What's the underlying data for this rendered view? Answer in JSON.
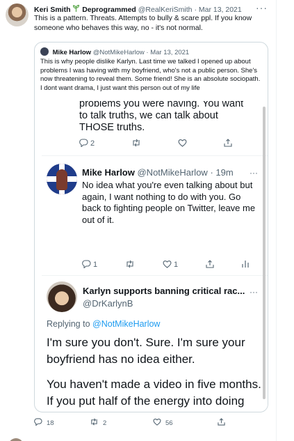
{
  "tweet": {
    "author_name": "Keri Smith",
    "author_tag": "Deprogrammed",
    "author_handle": "@RealKeriSmith",
    "date": "Mar 13, 2021",
    "more": "···",
    "text": "This is a pattern. Threats. Attempts to bully & scare ppl. If you know someone who behaves this way, no - it's not normal.",
    "actions": {
      "reply": "18",
      "retweet": "2",
      "like": "56"
    }
  },
  "quote": {
    "author_name": "Mike Harlow",
    "author_handle": "@NotMikeHarlow",
    "date": "Mar 13, 2021",
    "text": "This is why people dislike Karlyn. Last time we talked I opened up about problems I was having with my boyfriend, who's not a public person. She's now threatening to reveal them. Some friend! She is an absolute sociopath. I dont want drama, I just want this person out of my life"
  },
  "screenshot": {
    "fragment": "problems you were having. You want to talk truths, we can talk about THOSE truths.",
    "fragment_actions": {
      "reply": "2"
    },
    "mike": {
      "name": "Mike Harlow",
      "handle": "@NotMikeHarlow",
      "time": "19m",
      "more": "···",
      "text": "No idea what you're even talking about but again, I want nothing to do with you. Go back to fighting people on Twitter, leave me out of it.",
      "actions": {
        "reply": "1",
        "like": "1"
      }
    },
    "karlyn": {
      "name": "Karlyn supports banning critical rac...",
      "handle": "@DrKarlynB",
      "more": "···",
      "replying_prefix": "Replying to",
      "replying_to": "@NotMikeHarlow",
      "text1": "I'm sure you don't. Sure. I'm sure your boyfriend has no idea either.",
      "text2": "You haven't made a video in five months. If you put half of the energy into doing that as you do into hating me after I was always there for you, it would be a hell of a lot more"
    }
  },
  "icons": {
    "reply": "reply-icon",
    "retweet": "retweet-icon",
    "like": "heart-icon",
    "share": "share-icon",
    "analytics": "analytics-icon",
    "sprout": "sprout-icon"
  },
  "colors": {
    "link": "#1d9bf0",
    "muted": "#536471",
    "sprout": "#59a64a"
  }
}
